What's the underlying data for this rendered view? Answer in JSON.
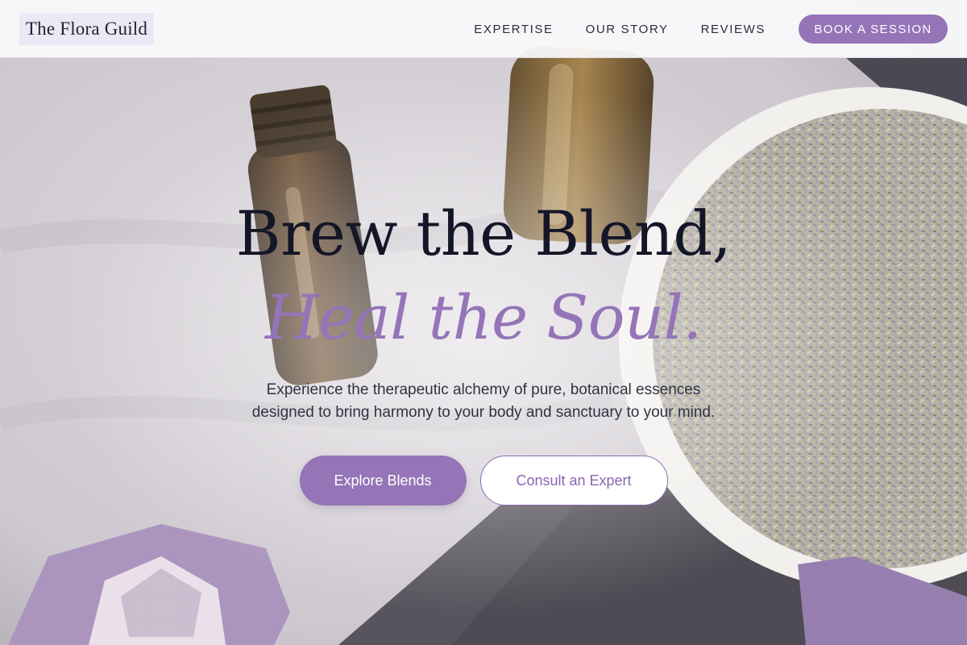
{
  "brand": {
    "logo_text": "The Flora Guild"
  },
  "nav": {
    "links": [
      "EXPERTISE",
      "OUR STORY",
      "REVIEWS"
    ],
    "cta_label": "BOOK A SESSION"
  },
  "hero": {
    "title_line1": "Brew the Blend,",
    "title_line2": "Heal the Soul.",
    "subtitle_line1": "Experience the therapeutic alchemy of pure, botanical essences",
    "subtitle_line2": "designed to bring harmony to your body and sanctuary to your mind.",
    "primary_button": "Explore Blends",
    "secondary_button": "Consult an Expert"
  },
  "colors": {
    "accent": "#9574b8",
    "heading": "#141628",
    "body_text": "#2f3342",
    "header_bg": "#f9f9fb"
  }
}
